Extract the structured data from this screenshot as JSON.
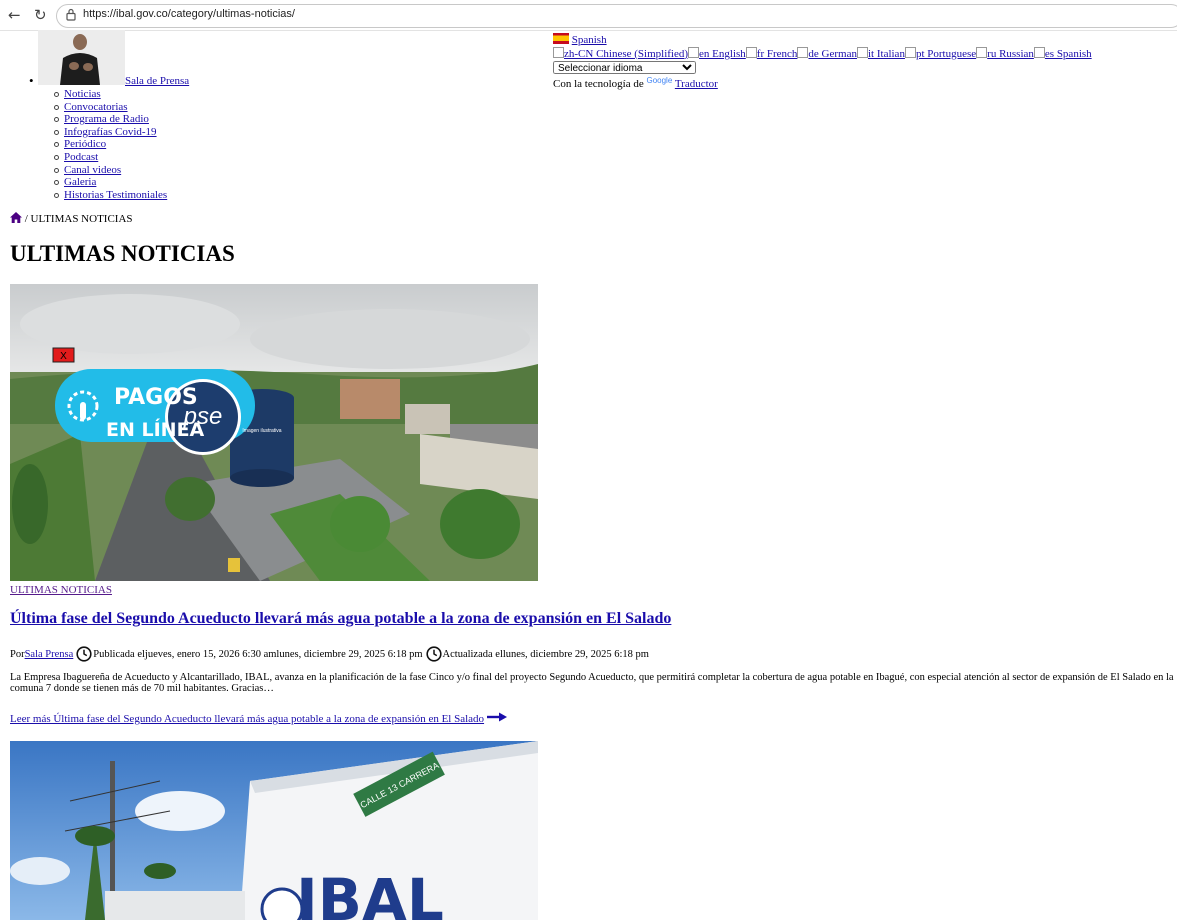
{
  "browser": {
    "url": "https://ibal.gov.co/category/ultimas-noticias/"
  },
  "menu": {
    "top_item": "Sala de Prensa",
    "sub_items": [
      "Noticias",
      "Convocatorias",
      "Programa de Radio",
      "Infografías Covid-19",
      "Periódico",
      "Podcast",
      "Canal videos",
      "Galeria",
      "Historias Testimoniales"
    ]
  },
  "translator": {
    "current_lang": "Spanish",
    "languages": [
      "zh-CN Chinese (Simplified)",
      "en English",
      "fr French",
      "de German",
      "it Italian",
      "pt Portuguese",
      "ru Russian",
      "es Spanish"
    ],
    "select_value": "Seleccionar idioma",
    "powered_prefix": "Con la tecnología de",
    "google_text": "Google",
    "translate_link": "Traductor"
  },
  "breadcrumb": {
    "current": "/ ULTIMAS NOTICIAS"
  },
  "page": {
    "title": "ULTIMAS NOTICIAS"
  },
  "article": {
    "image_text": {
      "close": "X",
      "line1": "PAGOS",
      "line2": "EN LÍNEA",
      "pse": "pse",
      "note": "Imagen ilustrativa"
    },
    "category": "ULTIMAS NOTICIAS",
    "headline": "Última fase del Segundo Acueducto llevará más agua potable a la zona de expansión en El Salado",
    "meta": {
      "by_prefix": "Por",
      "author": "Sala Prensa",
      "published": "Publicada eljueves, enero 15, 2026 6:30 amlunes, diciembre 29, 2025 6:18 pm",
      "updated": "Actualizada ellunes, diciembre 29, 2025 6:18 pm"
    },
    "excerpt": "La Empresa Ibaguereña de Acueducto y Alcantarillado, IBAL, avanza en la planificación de la fase Cinco y/o final del proyecto Segundo Acueducto, que permitirá completar la cobertura de agua potable en Ibagué, con especial atención al sector de expansión de El Salado en la comuna 7 donde se tienen más de 70 mil habitantes. Gracias…",
    "read_more": "Leer más Última fase del Segundo Acueducto llevará más agua potable a la zona de expansión en El Salado"
  },
  "article2": {
    "image_text": {
      "sign": "CALLE 13 CARRERA",
      "logo": "IBAL"
    }
  }
}
